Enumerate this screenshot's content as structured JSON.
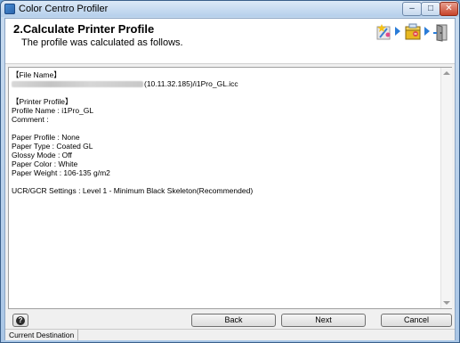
{
  "window": {
    "title": "Color Centro Profiler",
    "min_glyph": "–",
    "max_glyph": "□",
    "close_glyph": "✕"
  },
  "header": {
    "step_title": "2.Calculate Printer Profile",
    "step_subtitle": "The profile was calculated as follows."
  },
  "wizard_icons": [
    "sparkle-icon",
    "printer-box-icon",
    "door-exit-icon"
  ],
  "content": {
    "file_name_heading": "【File Name】",
    "file_name_suffix": "(10.11.32.185)/i1Pro_GL.icc",
    "printer_profile_heading": "【Printer Profile】",
    "profile_name": "Profile Name : i1Pro_GL",
    "comment": "Comment :",
    "paper_profile": "Paper Profile : None",
    "paper_type": "Paper Type : Coated GL",
    "glossy_mode": "Glossy Mode : Off",
    "paper_color": "Paper Color : White",
    "paper_weight": "Paper Weight : 106-135 g/m2",
    "ucr_gcr": "UCR/GCR Settings : Level 1 - Minimum Black Skeleton(Recommended)"
  },
  "buttons": {
    "help_glyph": "?",
    "back": "Back",
    "next": "Next",
    "cancel": "Cancel"
  },
  "status": {
    "current_destination": "Current Destination"
  }
}
